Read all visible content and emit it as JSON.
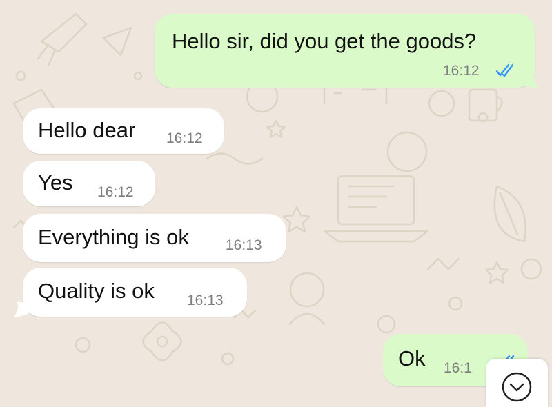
{
  "chat": {
    "messages": [
      {
        "direction": "outgoing",
        "text": "Hello sir, did you get the goods?",
        "time": "16:12",
        "status": "read",
        "status_icon": "double-check-icon"
      },
      {
        "direction": "incoming",
        "text": "Hello dear",
        "time": "16:12"
      },
      {
        "direction": "incoming",
        "text": "Yes",
        "time": "16:12"
      },
      {
        "direction": "incoming",
        "text": "Everything is ok",
        "time": "16:13"
      },
      {
        "direction": "incoming",
        "text": "Quality is ok",
        "time": "16:13"
      },
      {
        "direction": "outgoing",
        "text": "Ok",
        "time": "16:1",
        "status": "read",
        "status_icon": "double-check-icon"
      }
    ],
    "scroll_button_icon": "chevron-down-icon"
  },
  "colors": {
    "background": "#efe7dd",
    "outgoing_bubble": "#dafbc9",
    "incoming_bubble": "#ffffff",
    "read_check": "#3497f9",
    "timestamp": "#7d7d7d"
  }
}
